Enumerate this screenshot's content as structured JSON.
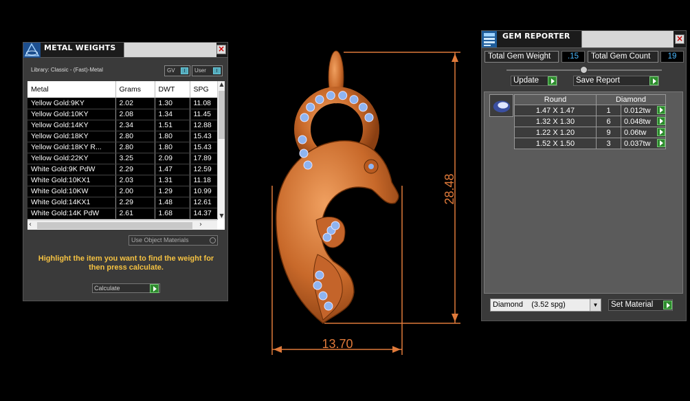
{
  "metal_weights": {
    "title": "METAL WEIGHTS",
    "library_label": "Library: Classic - (Fast)-Metal",
    "gv_label": "GV",
    "user_label": "User",
    "columns": [
      "Metal",
      "Grams",
      "DWT",
      "SPG"
    ],
    "rows": [
      [
        "Yellow Gold:9KY",
        "2.02",
        "1.30",
        "11.08"
      ],
      [
        "Yellow Gold:10KY",
        "2.08",
        "1.34",
        "11.45"
      ],
      [
        "Yellow Gold:14KY",
        "2.34",
        "1.51",
        "12.88"
      ],
      [
        "Yellow Gold:18KY",
        "2.80",
        "1.80",
        "15.43"
      ],
      [
        "Yellow Gold:18KY R...",
        "2.80",
        "1.80",
        "15.43"
      ],
      [
        "Yellow Gold:22KY",
        "3.25",
        "2.09",
        "17.89"
      ],
      [
        "White Gold:9K PdW",
        "2.29",
        "1.47",
        "12.59"
      ],
      [
        "White Gold:10KX1",
        "2.03",
        "1.31",
        "11.18"
      ],
      [
        "White Gold:10KW",
        "2.00",
        "1.29",
        "10.99"
      ],
      [
        "White Gold:14KX1",
        "2.29",
        "1.48",
        "12.61"
      ],
      [
        "White Gold:14K PdW",
        "2.61",
        "1.68",
        "14.37"
      ]
    ],
    "use_object_materials": "Use Object Materials",
    "hint": "Highlight the item you want to find the weight for then press calculate.",
    "calculate_label": "Calculate"
  },
  "gem_reporter": {
    "title": "GEM REPORTER",
    "total_weight_label": "Total Gem Weight",
    "total_weight_value": ".15",
    "total_count_label": "Total Gem Count",
    "total_count_value": "19",
    "update_label": "Update",
    "save_report_label": "Save Report",
    "table_headers": [
      "Round",
      "Diamond"
    ],
    "gems": [
      {
        "size": "1.47 X 1.47",
        "count": "1",
        "weight": "0.012tw"
      },
      {
        "size": "1.32 X 1.30",
        "count": "6",
        "weight": "0.048tw"
      },
      {
        "size": "1.22 X 1.20",
        "count": "9",
        "weight": "0.06tw"
      },
      {
        "size": "1.52 X 1.50",
        "count": "3",
        "weight": "0.037tw"
      }
    ],
    "material_select": "Diamond    (3.52 spg)",
    "set_material_label": "Set Material"
  },
  "viewport": {
    "height_dimension": "28.48",
    "width_dimension": "13.70",
    "dimension_color": "#e07a3a",
    "metal_color": "#d07a35",
    "gem_color": "#8fb4f0"
  },
  "icons": {
    "metal_logo": "metal-weights-icon",
    "gem_logo": "gem-reporter-icon",
    "close": "close-icon",
    "play": "play-arrow-icon"
  }
}
